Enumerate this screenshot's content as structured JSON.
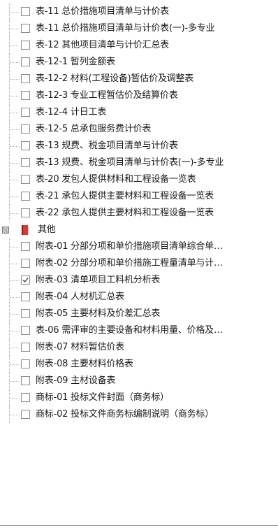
{
  "items_top": [
    {
      "label": "表-11 总价措施项目清单与计价表",
      "checked": false
    },
    {
      "label": "表-11 总价措施项目清单与计价表(一)-多专业",
      "checked": false
    },
    {
      "label": "表-12 其他项目清单与计价汇总表",
      "checked": false
    },
    {
      "label": "表-12-1 暂列金额表",
      "checked": false
    },
    {
      "label": "表-12-2 材料(工程设备)暂估价及调整表",
      "checked": false
    },
    {
      "label": "表-12-3 专业工程暂估价及结算价表",
      "checked": false
    },
    {
      "label": "表-12-4 计日工表",
      "checked": false
    },
    {
      "label": "表-12-5 总承包服务费计价表",
      "checked": false
    },
    {
      "label": "表-13 规费、税金项目清单与计价表",
      "checked": false
    },
    {
      "label": "表-13 规费、税金项目清单与计价表(一)-多专业",
      "checked": false
    },
    {
      "label": "表-20 发包人提供材料和工程设备一览表",
      "checked": false
    },
    {
      "label": "表-21 承包人提供主要材料和工程设备一览表",
      "checked": false
    },
    {
      "label": "表-22 承包人提供主要材料和工程设备一览表",
      "checked": false
    }
  ],
  "group": {
    "label": "其他",
    "icon": "book-icon",
    "expander": "partial-state-expander"
  },
  "items_group": [
    {
      "label": "附表-01 分部分项和单价措施项目清单综合单…",
      "checked": false
    },
    {
      "label": "附表-02 分部分项和单价措施工程量清单与计…",
      "checked": false
    },
    {
      "label": "附表-03 清单项目工料机分析表",
      "checked": true
    },
    {
      "label": "附表-04 人材机汇总表",
      "checked": false
    },
    {
      "label": "附表-05 主要材料及价差汇总表",
      "checked": false
    },
    {
      "label": "表-06 需评审的主要设备和材料用量、价格及…",
      "checked": false
    },
    {
      "label": "附表-07 材料暂估价表",
      "checked": false
    },
    {
      "label": "附表-08 主要材料价格表",
      "checked": false
    },
    {
      "label": "附表-09 主材设备表",
      "checked": false
    },
    {
      "label": "商标-01 投标文件封面（商务标）",
      "checked": false
    },
    {
      "label": "商标-02 投标文件商务标编制说明（商务标）",
      "checked": false
    }
  ],
  "colors": {
    "checkbox_border": "#8c8c8c",
    "checkmark": "#4a4a4a",
    "book_red": "#d23b3b",
    "book_dark": "#8b1c1c",
    "tree_line": "#b0b0b0"
  }
}
